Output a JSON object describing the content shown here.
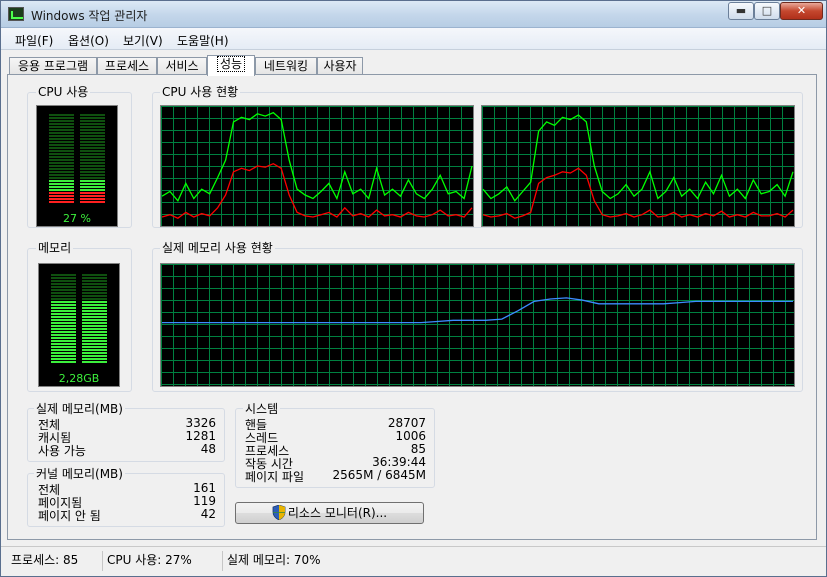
{
  "window": {
    "title": "Windows 작업 관리자"
  },
  "menu": [
    "파일(F)",
    "옵션(O)",
    "보기(V)",
    "도움말(H)"
  ],
  "tabs": [
    "응용 프로그램",
    "프로세스",
    "서비스",
    "성능",
    "네트워킹",
    "사용자"
  ],
  "active_tab": "성능",
  "cpu": {
    "group_title": "CPU 사용",
    "percent_label": "27 %",
    "percent": 27,
    "history_title": "CPU 사용 현황"
  },
  "memory": {
    "group_title": "메모리",
    "usage_label": "2,28GB",
    "fraction": 0.7,
    "history_title": "실제 메모리 사용 현황"
  },
  "physical_memory": {
    "title": "실제 메모리(MB)",
    "rows": [
      {
        "label": "전체",
        "value": "3326"
      },
      {
        "label": "캐시됨",
        "value": "1281"
      },
      {
        "label": "사용 가능",
        "value": "48"
      }
    ]
  },
  "kernel_memory": {
    "title": "커널 메모리(MB)",
    "rows": [
      {
        "label": "전체",
        "value": "161"
      },
      {
        "label": "페이지됨",
        "value": "119"
      },
      {
        "label": "페이지 안 됨",
        "value": "42"
      }
    ]
  },
  "system": {
    "title": "시스템",
    "rows": [
      {
        "label": "핸들",
        "value": "28707"
      },
      {
        "label": "스레드",
        "value": "1006"
      },
      {
        "label": "프로세스",
        "value": "85"
      },
      {
        "label": "작동 시간",
        "value": "36:39:44"
      },
      {
        "label": "페이지 파일",
        "value": "2565M / 6845M"
      }
    ]
  },
  "resource_monitor_button": "리소스 모니터(R)...",
  "status": {
    "processes": "프로세스: 85",
    "cpu": "CPU 사용: 27%",
    "memory": "실제 메모리: 70%"
  },
  "colors": {
    "graph_grid": "#008040",
    "cpu_total": "#00ff00",
    "cpu_kernel": "#ff0000",
    "memory_line": "#3c8cff",
    "meter_on": "#3cf03c",
    "meter_off": "#0f4f0f"
  },
  "chart_data": [
    {
      "type": "line",
      "name": "cpu-core-1",
      "x": [
        0,
        1,
        2,
        3,
        4,
        5,
        6,
        7,
        8,
        9,
        10,
        11,
        12,
        13,
        14,
        15,
        16,
        17,
        18,
        19,
        20,
        21,
        22,
        23,
        24,
        25,
        26,
        27,
        28,
        29,
        30,
        31,
        32,
        33,
        34,
        35,
        36,
        37,
        38,
        39
      ],
      "series": [
        {
          "values": [
            24,
            28,
            20,
            35,
            22,
            30,
            26,
            40,
            55,
            88,
            92,
            90,
            95,
            93,
            96,
            90,
            55,
            30,
            25,
            22,
            28,
            35,
            22,
            45,
            26,
            30,
            22,
            48,
            25,
            30,
            24,
            38,
            26,
            22,
            30,
            42,
            26,
            28,
            22,
            50
          ]
        },
        {
          "values": [
            6,
            8,
            5,
            10,
            6,
            9,
            7,
            14,
            25,
            45,
            48,
            46,
            50,
            49,
            52,
            48,
            25,
            10,
            7,
            6,
            8,
            10,
            6,
            14,
            7,
            9,
            6,
            12,
            7,
            8,
            6,
            10,
            7,
            6,
            8,
            12,
            7,
            8,
            6,
            14
          ]
        }
      ],
      "ylim": [
        0,
        100
      ]
    },
    {
      "type": "line",
      "name": "cpu-core-2",
      "x": [
        0,
        1,
        2,
        3,
        4,
        5,
        6,
        7,
        8,
        9,
        10,
        11,
        12,
        13,
        14,
        15,
        16,
        17,
        18,
        19,
        20,
        21,
        22,
        23,
        24,
        25,
        26,
        27,
        28,
        29,
        30,
        31,
        32,
        33,
        34,
        35,
        36,
        37,
        38,
        39
      ],
      "series": [
        {
          "values": [
            30,
            22,
            26,
            32,
            20,
            28,
            36,
            80,
            88,
            85,
            92,
            90,
            94,
            88,
            50,
            28,
            22,
            26,
            34,
            24,
            30,
            45,
            22,
            28,
            40,
            24,
            30,
            22,
            36,
            26,
            42,
            24,
            30,
            22,
            38,
            26,
            28,
            34,
            24,
            45
          ]
        },
        {
          "values": [
            8,
            6,
            7,
            9,
            5,
            7,
            10,
            35,
            40,
            42,
            45,
            44,
            48,
            42,
            20,
            8,
            6,
            7,
            9,
            6,
            8,
            12,
            6,
            7,
            10,
            6,
            8,
            6,
            9,
            7,
            11,
            6,
            8,
            6,
            10,
            7,
            7,
            9,
            6,
            12
          ]
        }
      ],
      "ylim": [
        0,
        100
      ]
    },
    {
      "type": "line",
      "name": "memory-history",
      "x": [
        0,
        1,
        2,
        3,
        4,
        5,
        6,
        7,
        8,
        9,
        10,
        11,
        12,
        13,
        14,
        15,
        16,
        17,
        18,
        19,
        20,
        21,
        22,
        23,
        24,
        25,
        26,
        27,
        28,
        29,
        30,
        31,
        32,
        33,
        34,
        35,
        36,
        37,
        38,
        39
      ],
      "series": [
        {
          "values": [
            52,
            52,
            52,
            52,
            52,
            52,
            52,
            52,
            52,
            52,
            52,
            52,
            52,
            52,
            52,
            52,
            52,
            53,
            54,
            54,
            54,
            55,
            62,
            70,
            72,
            73,
            71,
            68,
            68,
            68,
            68,
            68,
            69,
            70,
            70,
            70,
            70,
            70,
            70,
            70
          ]
        }
      ],
      "ylim": [
        0,
        100
      ]
    }
  ]
}
